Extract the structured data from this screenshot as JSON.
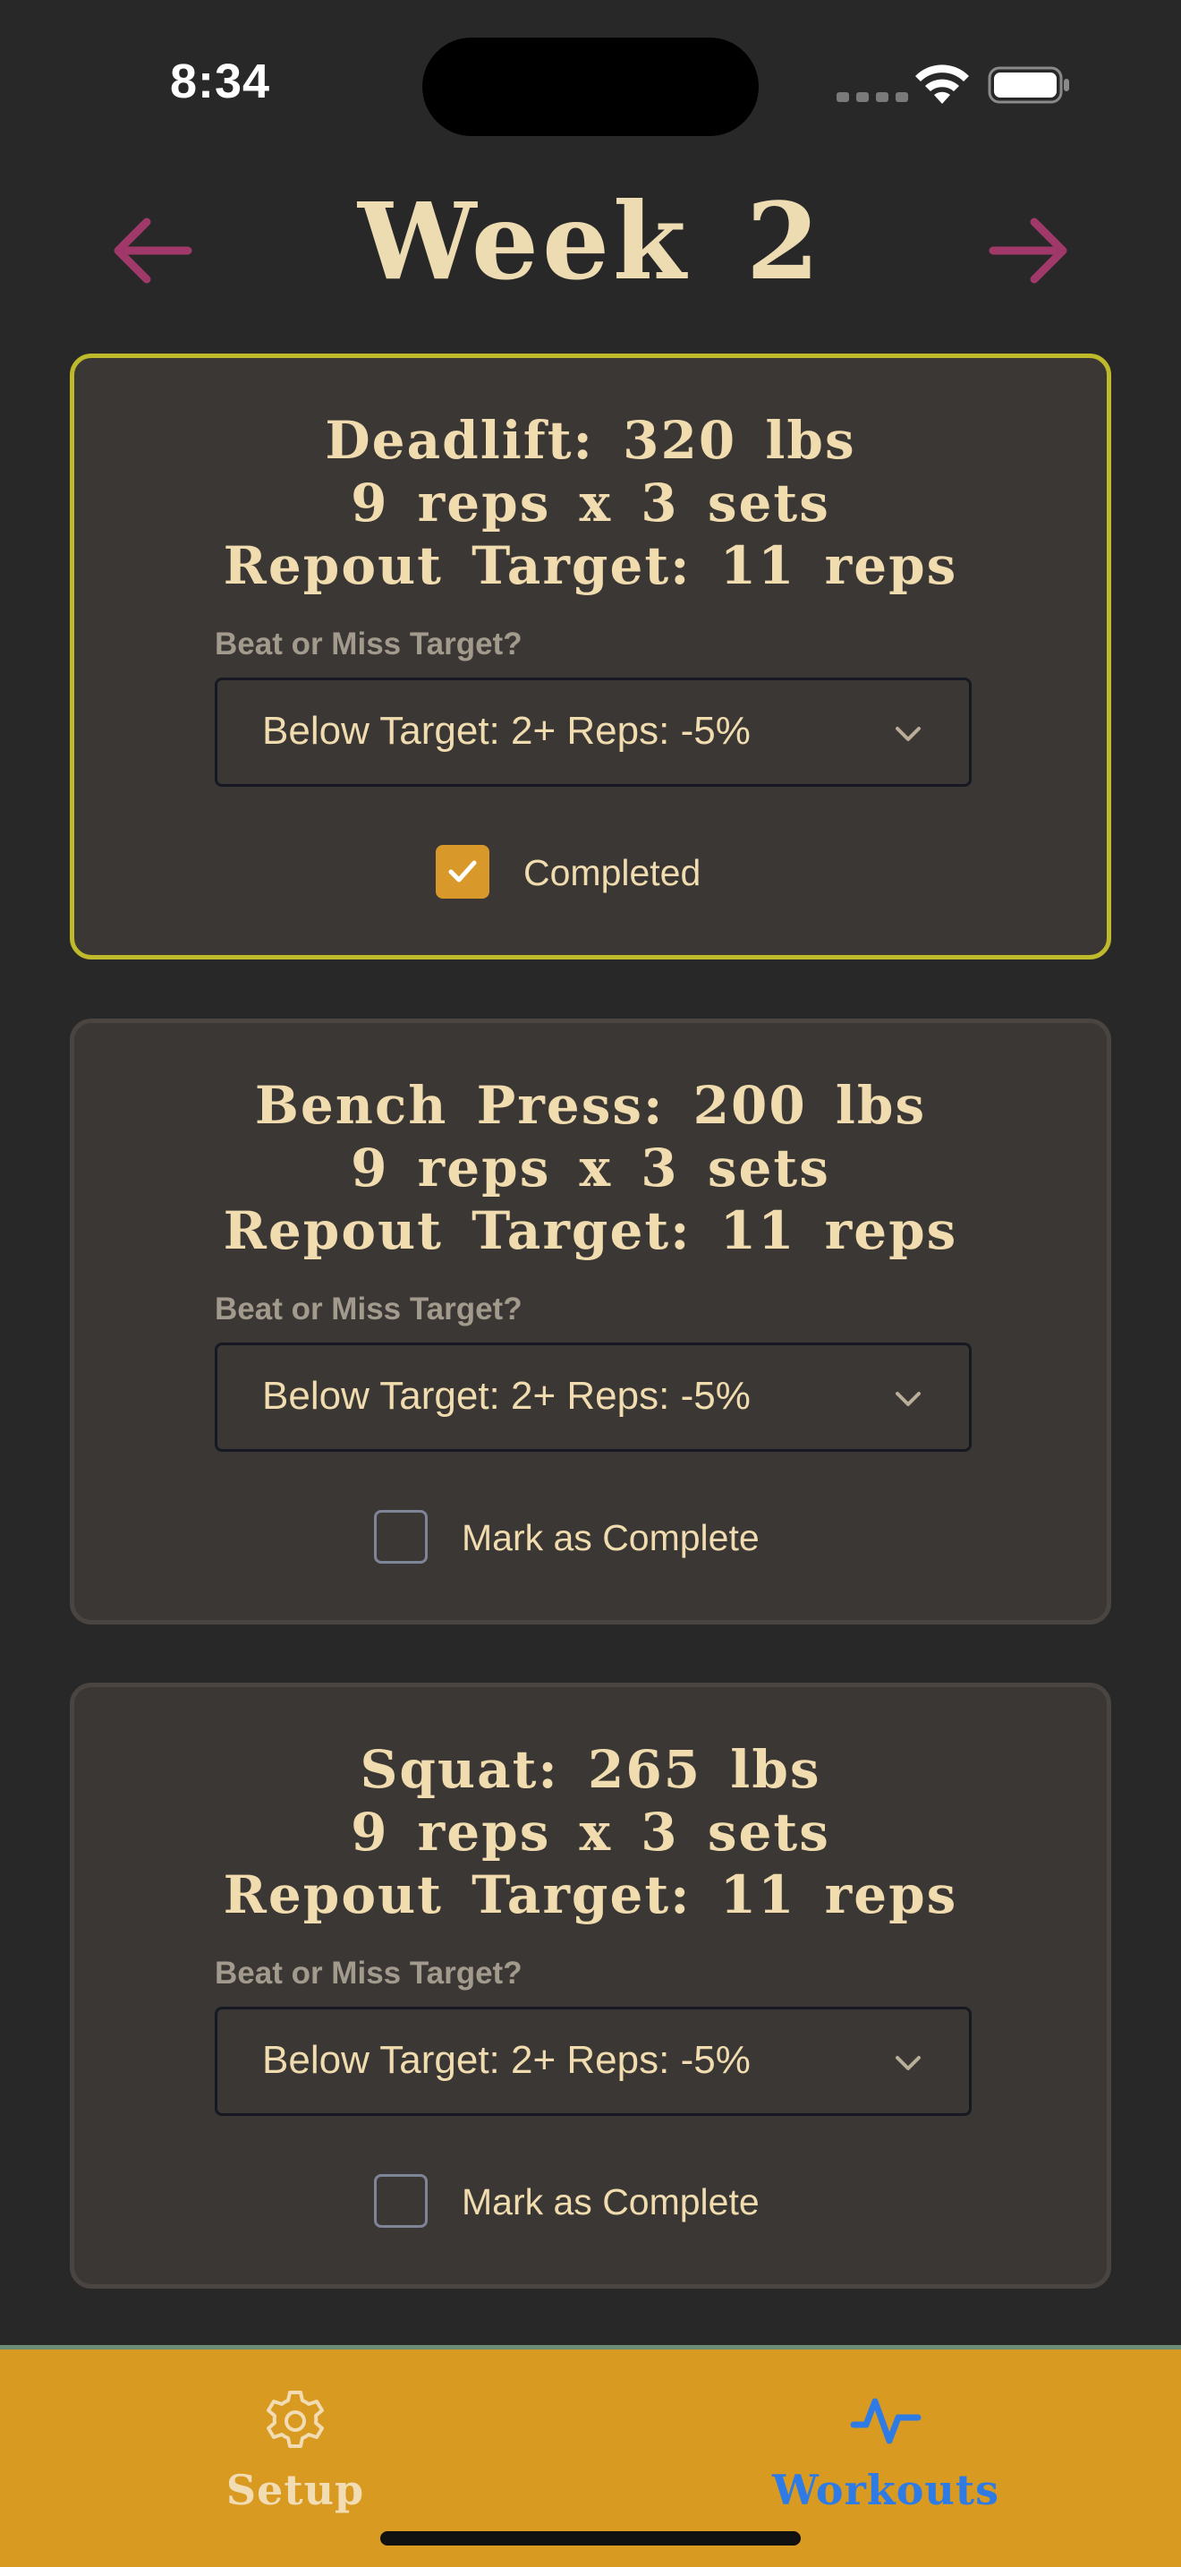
{
  "status_bar": {
    "time": "8:34"
  },
  "header": {
    "title": "Week 2"
  },
  "field_label": "Beat or Miss Target?",
  "cards": [
    {
      "line1": "Deadlift: 320 lbs",
      "line2": "9 reps x 3 sets",
      "line3": "Repout Target: 11 reps",
      "label": "Beat or Miss Target?",
      "select_value": "Below Target: 2+ Reps: -5%",
      "complete_label": "Completed",
      "completed": true
    },
    {
      "line1": "Bench Press: 200 lbs",
      "line2": "9 reps x 3 sets",
      "line3": "Repout Target: 11 reps",
      "label": "Beat or Miss Target?",
      "select_value": "Below Target: 2+ Reps: -5%",
      "complete_label": "Mark as Complete",
      "completed": false
    },
    {
      "line1": "Squat: 265 lbs",
      "line2": "9 reps x 3 sets",
      "line3": "Repout Target: 11 reps",
      "label": "Beat or Miss Target?",
      "select_value": "Below Target: 2+ Reps: -5%",
      "complete_label": "Mark as Complete",
      "completed": false
    }
  ],
  "tabbar": {
    "setup_label": "Setup",
    "workouts_label": "Workouts",
    "active": "workouts"
  },
  "colors": {
    "background": "#282828",
    "card": "#3b3734",
    "active_border": "#bfba2c",
    "arrow": "#a0396a",
    "tabbar": "#d99a22",
    "active_tab": "#2e7be6",
    "checkbox_checked": "#d9992a"
  },
  "icons": {
    "prev": "arrow-left-icon",
    "next": "arrow-right-icon",
    "select": "chevron-down-icon",
    "check": "checkmark-icon",
    "setup": "gear-icon",
    "workouts": "activity-pulse-icon"
  }
}
